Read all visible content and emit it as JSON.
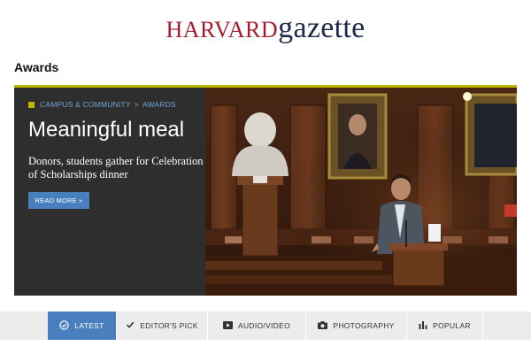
{
  "masthead": {
    "logo_harvard": "HARVARD",
    "logo_gazette": "gazette"
  },
  "section": {
    "title": "Awards"
  },
  "feature": {
    "crumb_primary": "CAMPUS & COMMUNITY",
    "crumb_separator": ">",
    "crumb_secondary": "AWARDS",
    "headline": "Meaningful meal",
    "dek": "Donors, students gather for Celebration of Scholarships dinner",
    "read_more": "READ MORE »"
  },
  "tabs": [
    {
      "label": "LATEST",
      "icon": "check-circle-icon",
      "active": true
    },
    {
      "label": "EDITOR'S PICK",
      "icon": "checkmark-icon",
      "active": false
    },
    {
      "label": "AUDIO/VIDEO",
      "icon": "play-icon",
      "active": false
    },
    {
      "label": "PHOTOGRAPHY",
      "icon": "camera-icon",
      "active": false
    },
    {
      "label": "POPULAR",
      "icon": "bar-chart-icon",
      "active": false
    }
  ],
  "colors": {
    "brand_crimson": "#a51c30",
    "brand_navy": "#1e2a4a",
    "accent_olive": "#bdb800",
    "link_blue": "#4a7fbf"
  }
}
